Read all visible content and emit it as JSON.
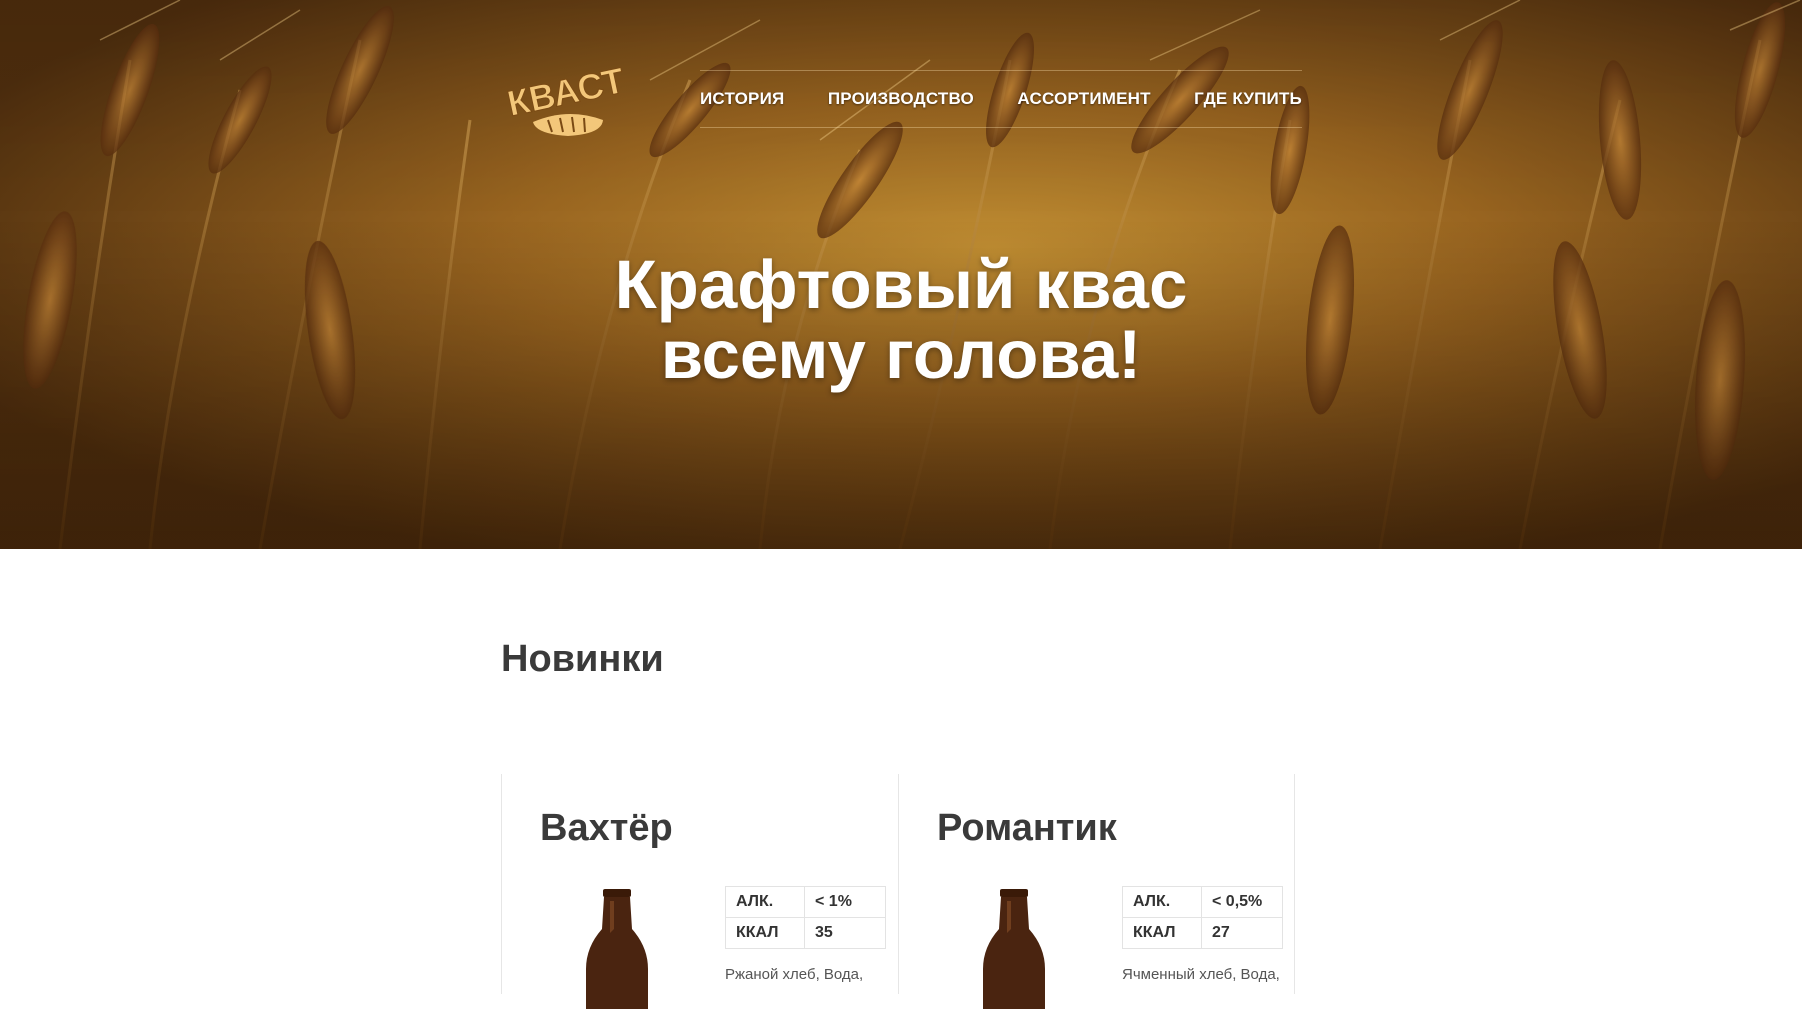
{
  "header": {
    "logo_text": "КВАСТ",
    "nav": [
      {
        "label": "ИСТОРИЯ"
      },
      {
        "label": "ПРОИЗВОДСТВО"
      },
      {
        "label": "АССОРТИМЕНТ"
      },
      {
        "label": "ГДЕ КУПИТЬ"
      }
    ]
  },
  "hero": {
    "title_line1": "Крафтовый квас",
    "title_line2": "всему голова!"
  },
  "main": {
    "section_title": "Новинки",
    "products": [
      {
        "name": "Вахтёр",
        "specs": [
          {
            "label": "АЛК.",
            "value": "< 1%"
          },
          {
            "label": "ККАЛ",
            "value": "35"
          }
        ],
        "ingredients": "Ржаной хлеб, Вода,"
      },
      {
        "name": "Романтик",
        "specs": [
          {
            "label": "АЛК.",
            "value": "< 0,5%"
          },
          {
            "label": "ККАЛ",
            "value": "27"
          }
        ],
        "ingredients": "Ячменный хлеб, Вода,"
      }
    ]
  },
  "colors": {
    "logo": "#f3c77a",
    "text_dark": "#3a3a3a",
    "bottle": "#4a2410"
  }
}
